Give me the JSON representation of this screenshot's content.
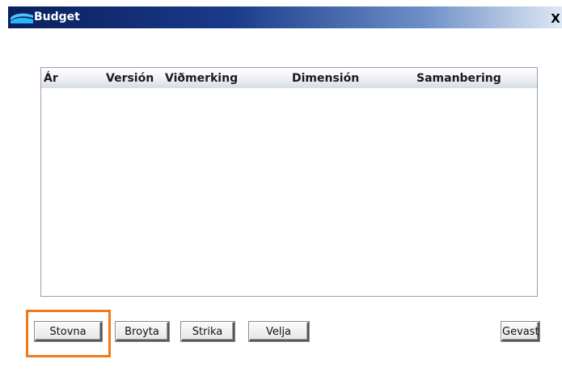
{
  "window": {
    "title": "Budget",
    "close_label": "X",
    "icon": "app-logo-icon"
  },
  "grid": {
    "columns": [
      "Ár",
      "Versión",
      "Viðmerking",
      "Dimensión",
      "Samanbering"
    ],
    "rows": []
  },
  "buttons": {
    "stovna": "Stovna",
    "broyta": "Broyta",
    "strika": "Strika",
    "velja": "Velja",
    "gevast": "Gevast"
  },
  "colors": {
    "titlebar_dark": "#0b1f5c",
    "titlebar_light": "#dfe8f5",
    "highlight": "#f07a1a"
  }
}
